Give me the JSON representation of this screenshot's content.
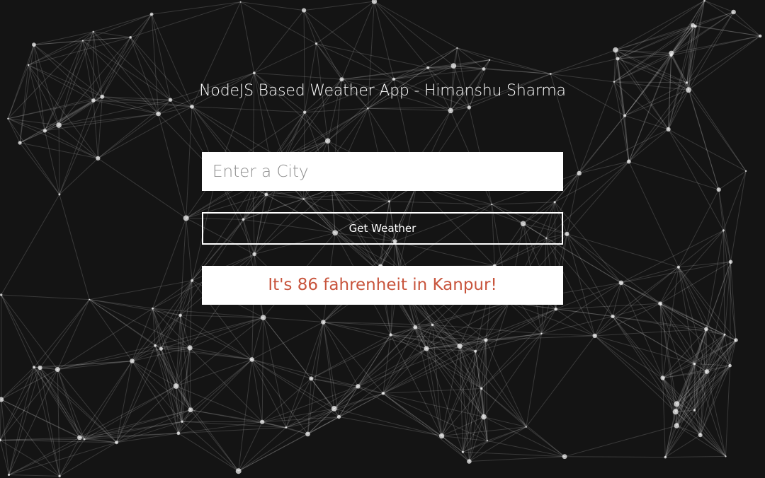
{
  "app": {
    "title": "NodeJS Based Weather App - Himanshu Sharma"
  },
  "form": {
    "city_placeholder": "Enter a City",
    "city_value": "",
    "submit_label": "Get Weather"
  },
  "result": {
    "message": "It's 86 fahrenheit in Kanpur!"
  },
  "colors": {
    "background": "#141414",
    "network_lines": "#ffffff",
    "result_text": "#c8553d"
  }
}
